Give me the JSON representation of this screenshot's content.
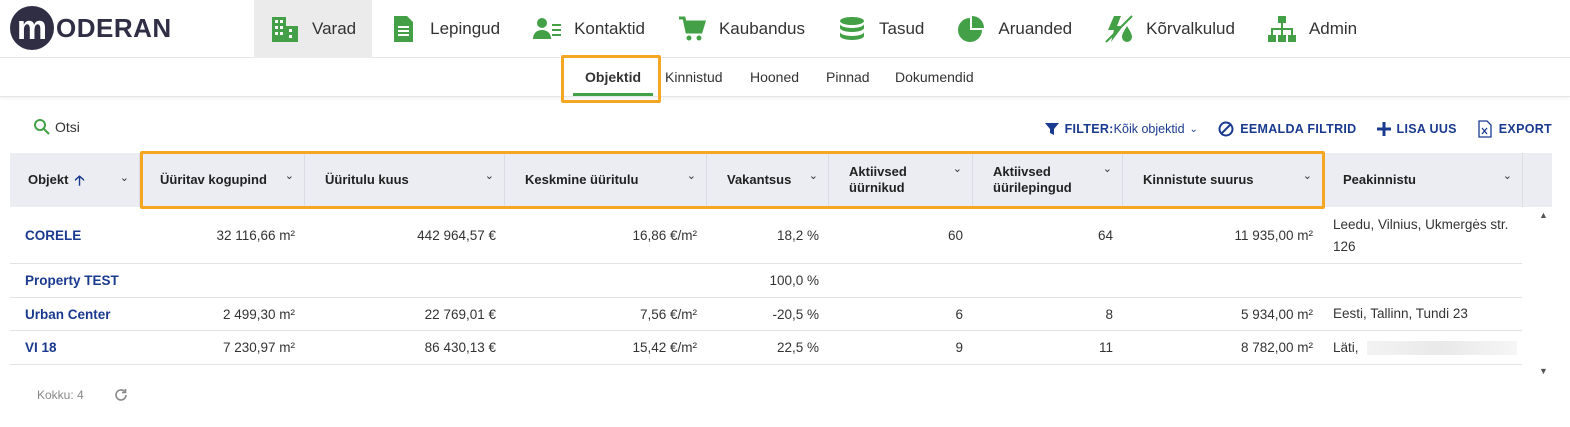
{
  "logo": {
    "mark": "m",
    "text": "ODERAN"
  },
  "nav": {
    "items": [
      {
        "label": "Varad",
        "icon": "buildings-icon"
      },
      {
        "label": "Lepingud",
        "icon": "document-icon"
      },
      {
        "label": "Kontaktid",
        "icon": "contacts-icon"
      },
      {
        "label": "Kaubandus",
        "icon": "cart-icon"
      },
      {
        "label": "Tasud",
        "icon": "coins-icon"
      },
      {
        "label": "Aruanded",
        "icon": "pie-chart-icon"
      },
      {
        "label": "Kõrvalkulud",
        "icon": "utility-icon"
      },
      {
        "label": "Admin",
        "icon": "org-chart-icon"
      }
    ]
  },
  "subnav": {
    "items": [
      "Objektid",
      "Kinnistud",
      "Hooned",
      "Pinnad",
      "Dokumendid"
    ]
  },
  "toolbar": {
    "search_label": "Otsi",
    "filter_label": "FILTER:",
    "filter_value": "Kõik objektid",
    "remove_filters": "EEMALDA FILTRID",
    "add_new": "LISA UUS",
    "export": "EXPORT"
  },
  "table": {
    "columns": [
      "Objekt",
      "Üüritav kogupind",
      "Üüritulu kuus",
      "Keskmine üüritulu",
      "Vakantsus",
      "Aktiivsed üürnikud",
      "Aktiivsed üürilepingud",
      "Kinnistute suurus",
      "Peakinnistu"
    ],
    "col_lines": {
      "c5a": "Aktiivsed",
      "c5b": "üürnikud",
      "c6a": "Aktiivsed",
      "c6b": "üürilepingud"
    },
    "rows": [
      {
        "objekt": "CORELE",
        "pind": "32 116,66 m²",
        "tulu": "442 964,57 €",
        "keskmine": "16,86 €/m²",
        "vakantsus": "18,2 %",
        "uurnikud": "60",
        "lepingud": "64",
        "suurus": "11 935,00 m²",
        "peakinnistu": "Leedu, Vilnius, Ukmergės str. 126"
      },
      {
        "objekt": "Property TEST",
        "pind": "",
        "tulu": "",
        "keskmine": "",
        "vakantsus": "100,0 %",
        "uurnikud": "",
        "lepingud": "",
        "suurus": "",
        "peakinnistu": ""
      },
      {
        "objekt": "Urban Center",
        "pind": "2 499,30 m²",
        "tulu": "22 769,01 €",
        "keskmine": "7,56 €/m²",
        "vakantsus": "-20,5 %",
        "uurnikud": "6",
        "lepingud": "8",
        "suurus": "5 934,00 m²",
        "peakinnistu": "Eesti, Tallinn, Tundi 23"
      },
      {
        "objekt": "VI 18",
        "pind": "7 230,97 m²",
        "tulu": "86 430,13 €",
        "keskmine": "15,42 €/m²",
        "vakantsus": "22,5 %",
        "uurnikud": "9",
        "lepingud": "11",
        "suurus": "8 782,00 m²",
        "peakinnistu": "Läti,"
      }
    ]
  },
  "footer": {
    "total": "Kokku: 4"
  },
  "colors": {
    "accent_green": "#43a047",
    "link_blue": "#1a3a8f",
    "highlight": "#f5a623"
  }
}
